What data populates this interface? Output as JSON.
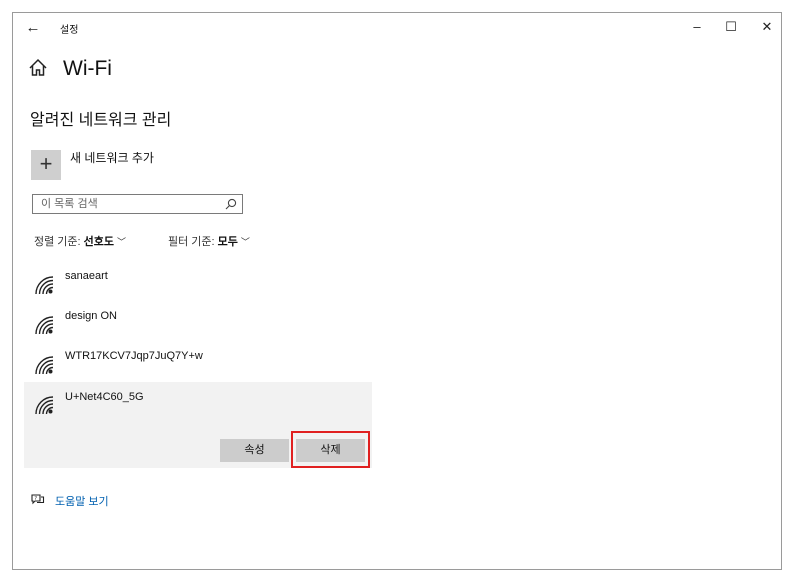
{
  "window": {
    "title": "설정",
    "back_glyph": "←",
    "minimize_glyph": "–",
    "maximize_glyph": "☐",
    "close_glyph": "✕"
  },
  "page": {
    "title": "Wi-Fi",
    "section_title": "알려진 네트워크 관리"
  },
  "add_network": {
    "icon_glyph": "+",
    "label": "새 네트워크 추가"
  },
  "search": {
    "placeholder": "이 목록 검색",
    "value": ""
  },
  "sort": {
    "label": "정렬 기준:",
    "value": "선호도"
  },
  "filter": {
    "label": "필터 기준:",
    "value": "모두"
  },
  "networks": [
    {
      "name": "sanaeart",
      "selected": false
    },
    {
      "name": "design ON",
      "selected": false
    },
    {
      "name": "WTR17KCV7Jqp7JuQ7Y+w",
      "selected": false
    },
    {
      "name": "U+Net4C60_5G",
      "selected": true
    }
  ],
  "actions": {
    "properties_label": "속성",
    "delete_label": "삭제"
  },
  "help": {
    "label": "도움말 보기"
  },
  "colors": {
    "link": "#0060b0",
    "highlight": "#e02020",
    "selected_bg": "#f2f2f2",
    "button_bg": "#cccccc"
  }
}
